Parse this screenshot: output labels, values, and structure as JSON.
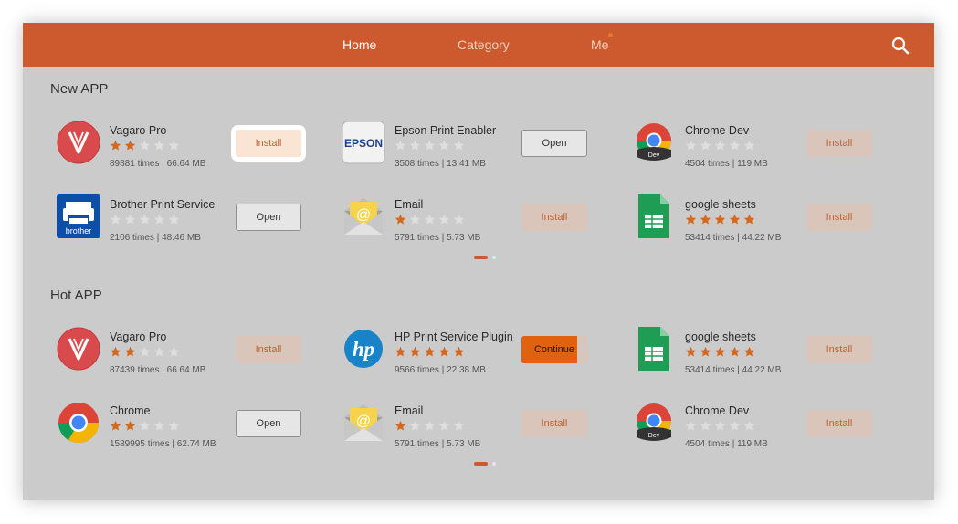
{
  "nav": {
    "tabs": [
      {
        "label": "Home",
        "active": true
      },
      {
        "label": "Category",
        "active": false
      },
      {
        "label": "Me",
        "active": false,
        "has_notification": true
      }
    ]
  },
  "sections": [
    {
      "title": "New APP",
      "apps": [
        {
          "name": "Vagaro Pro",
          "rating": 2,
          "meta": "89881 times | 66.64 MB",
          "action": "Install",
          "icon": "vagaro-icon",
          "focused": true
        },
        {
          "name": "Epson Print Enabler",
          "rating": 0,
          "meta": "3508 times | 13.41 MB",
          "action": "Open",
          "icon": "epson-icon"
        },
        {
          "name": "Chrome Dev",
          "rating": 0,
          "meta": "4504 times | 119 MB",
          "action": "Install",
          "icon": "chrome-dev-icon"
        },
        {
          "name": "Brother Print Service",
          "rating": 0,
          "meta": "2106 times | 48.46 MB",
          "action": "Open",
          "icon": "brother-icon"
        },
        {
          "name": "Email",
          "rating": 1,
          "meta": "5791 times | 5.73 MB",
          "action": "Install",
          "icon": "email-icon"
        },
        {
          "name": "google sheets",
          "rating": 5,
          "meta": "53414 times | 44.22 MB",
          "action": "Install",
          "icon": "google-sheets-icon"
        }
      ]
    },
    {
      "title": "Hot APP",
      "apps": [
        {
          "name": "Vagaro Pro",
          "rating": 2,
          "meta": "87439 times | 66.64 MB",
          "action": "Install",
          "icon": "vagaro-icon"
        },
        {
          "name": "HP Print Service Plugin",
          "rating": 5,
          "meta": "9566 times | 22.38 MB",
          "action": "Continue",
          "icon": "hp-icon",
          "progress": 0.85
        },
        {
          "name": "google sheets",
          "rating": 5,
          "meta": "53414 times | 44.22 MB",
          "action": "Install",
          "icon": "google-sheets-icon"
        },
        {
          "name": "Chrome",
          "rating": 2,
          "meta": "1589995 times | 62.74 MB",
          "action": "Open",
          "icon": "chrome-icon"
        },
        {
          "name": "Email",
          "rating": 1,
          "meta": "5791 times | 5.73 MB",
          "action": "Install",
          "icon": "email-icon"
        },
        {
          "name": "Chrome Dev",
          "rating": 0,
          "meta": "4504 times | 119 MB",
          "action": "Install",
          "icon": "chrome-dev-icon"
        }
      ]
    }
  ],
  "icons": {
    "epson_text": "EPSON",
    "brother_text": "brother",
    "chrome_dev_text": "Dev",
    "search": "search-icon"
  },
  "colors": {
    "accent": "#cd5a2f",
    "star_on": "#d2691e",
    "star_off": "#dedede",
    "install_bg": "#d9c5b9",
    "continue_fill": "#e0620e"
  }
}
